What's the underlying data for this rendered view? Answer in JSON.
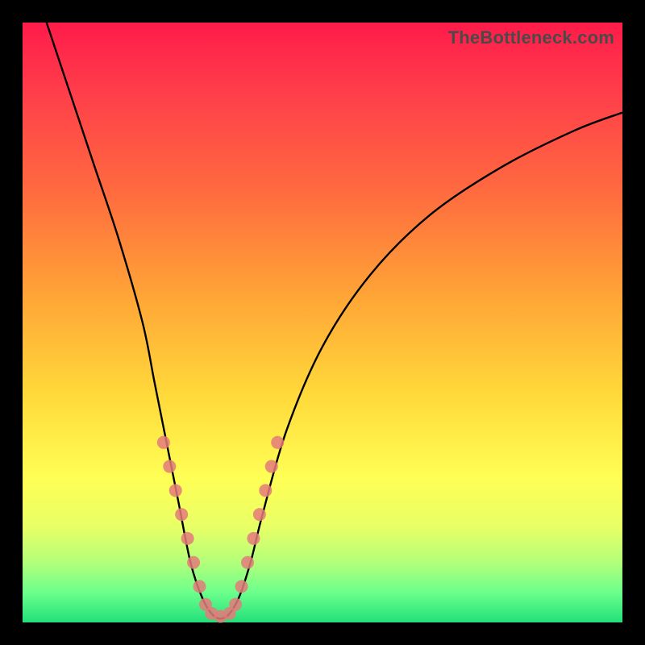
{
  "watermark": "TheBottleneck.com",
  "chart_data": {
    "type": "line",
    "title": "",
    "xlabel": "",
    "ylabel": "",
    "xlim": [
      0,
      100
    ],
    "ylim": [
      0,
      100
    ],
    "curve": {
      "points": [
        {
          "x": 4,
          "y": 100
        },
        {
          "x": 8,
          "y": 88
        },
        {
          "x": 12,
          "y": 76
        },
        {
          "x": 16,
          "y": 64
        },
        {
          "x": 20,
          "y": 50
        },
        {
          "x": 22,
          "y": 40
        },
        {
          "x": 24,
          "y": 30
        },
        {
          "x": 26,
          "y": 20
        },
        {
          "x": 28,
          "y": 10
        },
        {
          "x": 30,
          "y": 4
        },
        {
          "x": 32,
          "y": 1
        },
        {
          "x": 34,
          "y": 1
        },
        {
          "x": 36,
          "y": 4
        },
        {
          "x": 38,
          "y": 10
        },
        {
          "x": 40,
          "y": 18
        },
        {
          "x": 44,
          "y": 32
        },
        {
          "x": 50,
          "y": 46
        },
        {
          "x": 58,
          "y": 58
        },
        {
          "x": 68,
          "y": 68
        },
        {
          "x": 80,
          "y": 76
        },
        {
          "x": 92,
          "y": 82
        },
        {
          "x": 100,
          "y": 85
        }
      ]
    },
    "highlight_dots": [
      {
        "x": 23.5,
        "y": 30
      },
      {
        "x": 24.5,
        "y": 26
      },
      {
        "x": 25.5,
        "y": 22
      },
      {
        "x": 26.5,
        "y": 18
      },
      {
        "x": 27.5,
        "y": 14
      },
      {
        "x": 28.5,
        "y": 10
      },
      {
        "x": 29.5,
        "y": 6
      },
      {
        "x": 30.5,
        "y": 3
      },
      {
        "x": 31.5,
        "y": 1.5
      },
      {
        "x": 33,
        "y": 1
      },
      {
        "x": 34.5,
        "y": 1.5
      },
      {
        "x": 35.5,
        "y": 3
      },
      {
        "x": 36.5,
        "y": 6
      },
      {
        "x": 37.5,
        "y": 10
      },
      {
        "x": 38.5,
        "y": 14
      },
      {
        "x": 39.5,
        "y": 18
      },
      {
        "x": 40.5,
        "y": 22
      },
      {
        "x": 41.5,
        "y": 26
      },
      {
        "x": 42.5,
        "y": 30
      }
    ]
  }
}
